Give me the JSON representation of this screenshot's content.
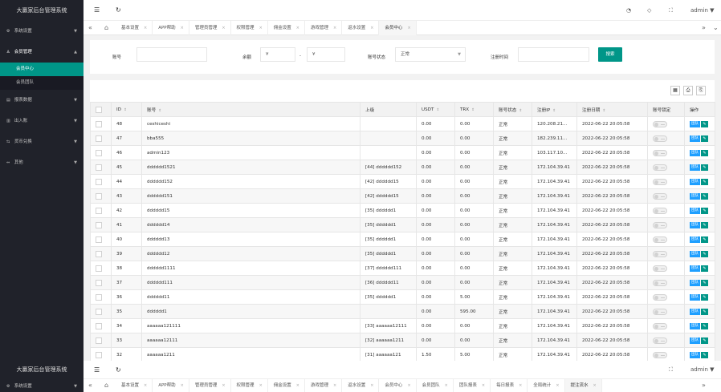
{
  "app": {
    "title": "大赢家后台管理系统"
  },
  "sidebar": {
    "items": [
      {
        "label": "系统设置",
        "icon": "gear-icon",
        "glyph": "⚙"
      },
      {
        "label": "会员管理",
        "icon": "user-icon",
        "glyph": "♙"
      },
      {
        "label": "报表数据",
        "icon": "report-icon",
        "glyph": "▤"
      },
      {
        "label": "出入账",
        "icon": "bank-icon",
        "glyph": "▥"
      },
      {
        "label": "货币兑换",
        "icon": "exchange-icon",
        "glyph": "⇆"
      },
      {
        "label": "其他",
        "icon": "misc-icon",
        "glyph": "⇔"
      }
    ],
    "sub_items": [
      {
        "label": "会员中心"
      },
      {
        "label": "会员团队"
      }
    ]
  },
  "topbar": {
    "user": "admin"
  },
  "tabs": [
    {
      "label": "基本设置"
    },
    {
      "label": "APP帮助"
    },
    {
      "label": "管理员管理"
    },
    {
      "label": "权限管理"
    },
    {
      "label": "佣金设置"
    },
    {
      "label": "游戏管理"
    },
    {
      "label": "返水设置"
    },
    {
      "label": "会员中心"
    }
  ],
  "tabs_bottom": [
    {
      "label": "基本设置"
    },
    {
      "label": "APP帮助"
    },
    {
      "label": "管理员管理"
    },
    {
      "label": "权限管理"
    },
    {
      "label": "佣金设置"
    },
    {
      "label": "游戏管理"
    },
    {
      "label": "返水设置"
    },
    {
      "label": "会员中心"
    },
    {
      "label": "会员团队"
    },
    {
      "label": "团队报表"
    },
    {
      "label": "每日报表"
    },
    {
      "label": "全局统计"
    },
    {
      "label": "提注流水"
    }
  ],
  "search": {
    "account_label": "账号",
    "balance_label": "余额",
    "currency_symbol": "¥",
    "range_sep": "-",
    "status_label": "账号状态",
    "status_value": "正常",
    "regtime_label": "注册时间",
    "search_button": "搜索"
  },
  "table": {
    "headers": {
      "id": "ID",
      "account": "账号",
      "parent": "上级",
      "usdt": "USDT",
      "trx": "TRX",
      "status": "账号状态",
      "ip": "注册IP",
      "date": "注册日期",
      "lock": "账号锁定",
      "ops": "操作"
    },
    "team_label": "团队",
    "rows": [
      {
        "id": "48",
        "account": "ceshiceshi",
        "parent": "",
        "usdt": "0.00",
        "trx": "0.00",
        "status": "正常",
        "ip": "120.208.21...",
        "date": "2022-06-22 20:05:58"
      },
      {
        "id": "47",
        "account": "bba555",
        "parent": "",
        "usdt": "0.00",
        "trx": "0.00",
        "status": "正常",
        "ip": "182.239.11...",
        "date": "2022-06-22 20:05:58"
      },
      {
        "id": "46",
        "account": "admin123",
        "parent": "",
        "usdt": "0.00",
        "trx": "0.00",
        "status": "正常",
        "ip": "103.117.10...",
        "date": "2022-06-22 20:05:58"
      },
      {
        "id": "45",
        "account": "dddddd1521",
        "parent": "[44] dddddd152",
        "usdt": "0.00",
        "trx": "0.00",
        "status": "正常",
        "ip": "172.104.39.41",
        "date": "2022-06-22 20:05:58"
      },
      {
        "id": "44",
        "account": "dddddd152",
        "parent": "[42] dddddd15",
        "usdt": "0.00",
        "trx": "0.00",
        "status": "正常",
        "ip": "172.104.39.41",
        "date": "2022-06-22 20:05:58"
      },
      {
        "id": "43",
        "account": "dddddd151",
        "parent": "[42] dddddd15",
        "usdt": "0.00",
        "trx": "0.00",
        "status": "正常",
        "ip": "172.104.39.41",
        "date": "2022-06-22 20:05:58"
      },
      {
        "id": "42",
        "account": "dddddd15",
        "parent": "[35] dddddd1",
        "usdt": "0.00",
        "trx": "0.00",
        "status": "正常",
        "ip": "172.104.39.41",
        "date": "2022-06-22 20:05:58"
      },
      {
        "id": "41",
        "account": "dddddd14",
        "parent": "[35] dddddd1",
        "usdt": "0.00",
        "trx": "0.00",
        "status": "正常",
        "ip": "172.104.39.41",
        "date": "2022-06-22 20:05:58"
      },
      {
        "id": "40",
        "account": "dddddd13",
        "parent": "[35] dddddd1",
        "usdt": "0.00",
        "trx": "0.00",
        "status": "正常",
        "ip": "172.104.39.41",
        "date": "2022-06-22 20:05:58"
      },
      {
        "id": "39",
        "account": "dddddd12",
        "parent": "[35] dddddd1",
        "usdt": "0.00",
        "trx": "0.00",
        "status": "正常",
        "ip": "172.104.39.41",
        "date": "2022-06-22 20:05:58"
      },
      {
        "id": "38",
        "account": "dddddd1111",
        "parent": "[37] dddddd111",
        "usdt": "0.00",
        "trx": "0.00",
        "status": "正常",
        "ip": "172.104.39.41",
        "date": "2022-06-22 20:05:58"
      },
      {
        "id": "37",
        "account": "dddddd111",
        "parent": "[36] dddddd11",
        "usdt": "0.00",
        "trx": "0.00",
        "status": "正常",
        "ip": "172.104.39.41",
        "date": "2022-06-22 20:05:58"
      },
      {
        "id": "36",
        "account": "dddddd11",
        "parent": "[35] dddddd1",
        "usdt": "0.00",
        "trx": "5.00",
        "status": "正常",
        "ip": "172.104.39.41",
        "date": "2022-06-22 20:05:58"
      },
      {
        "id": "35",
        "account": "dddddd1",
        "parent": "",
        "usdt": "0.00",
        "trx": "595.00",
        "status": "正常",
        "ip": "172.104.39.41",
        "date": "2022-06-22 20:05:58"
      },
      {
        "id": "34",
        "account": "aaaaaa121111",
        "parent": "[33] aaaaaa12111",
        "usdt": "0.00",
        "trx": "0.00",
        "status": "正常",
        "ip": "172.104.39.41",
        "date": "2022-06-22 20:05:58"
      },
      {
        "id": "33",
        "account": "aaaaaa12111",
        "parent": "[32] aaaaaa1211",
        "usdt": "0.00",
        "trx": "0.00",
        "status": "正常",
        "ip": "172.104.39.41",
        "date": "2022-06-22 20:05:58"
      },
      {
        "id": "32",
        "account": "aaaaaa1211",
        "parent": "[31] aaaaaa121",
        "usdt": "1.50",
        "trx": "5.00",
        "status": "正常",
        "ip": "172.104.39.41",
        "date": "2022-06-22 20:05:58"
      }
    ]
  },
  "colors": {
    "accent": "#009688",
    "sidebar_bg": "#20222a",
    "blue": "#1e9fff"
  }
}
